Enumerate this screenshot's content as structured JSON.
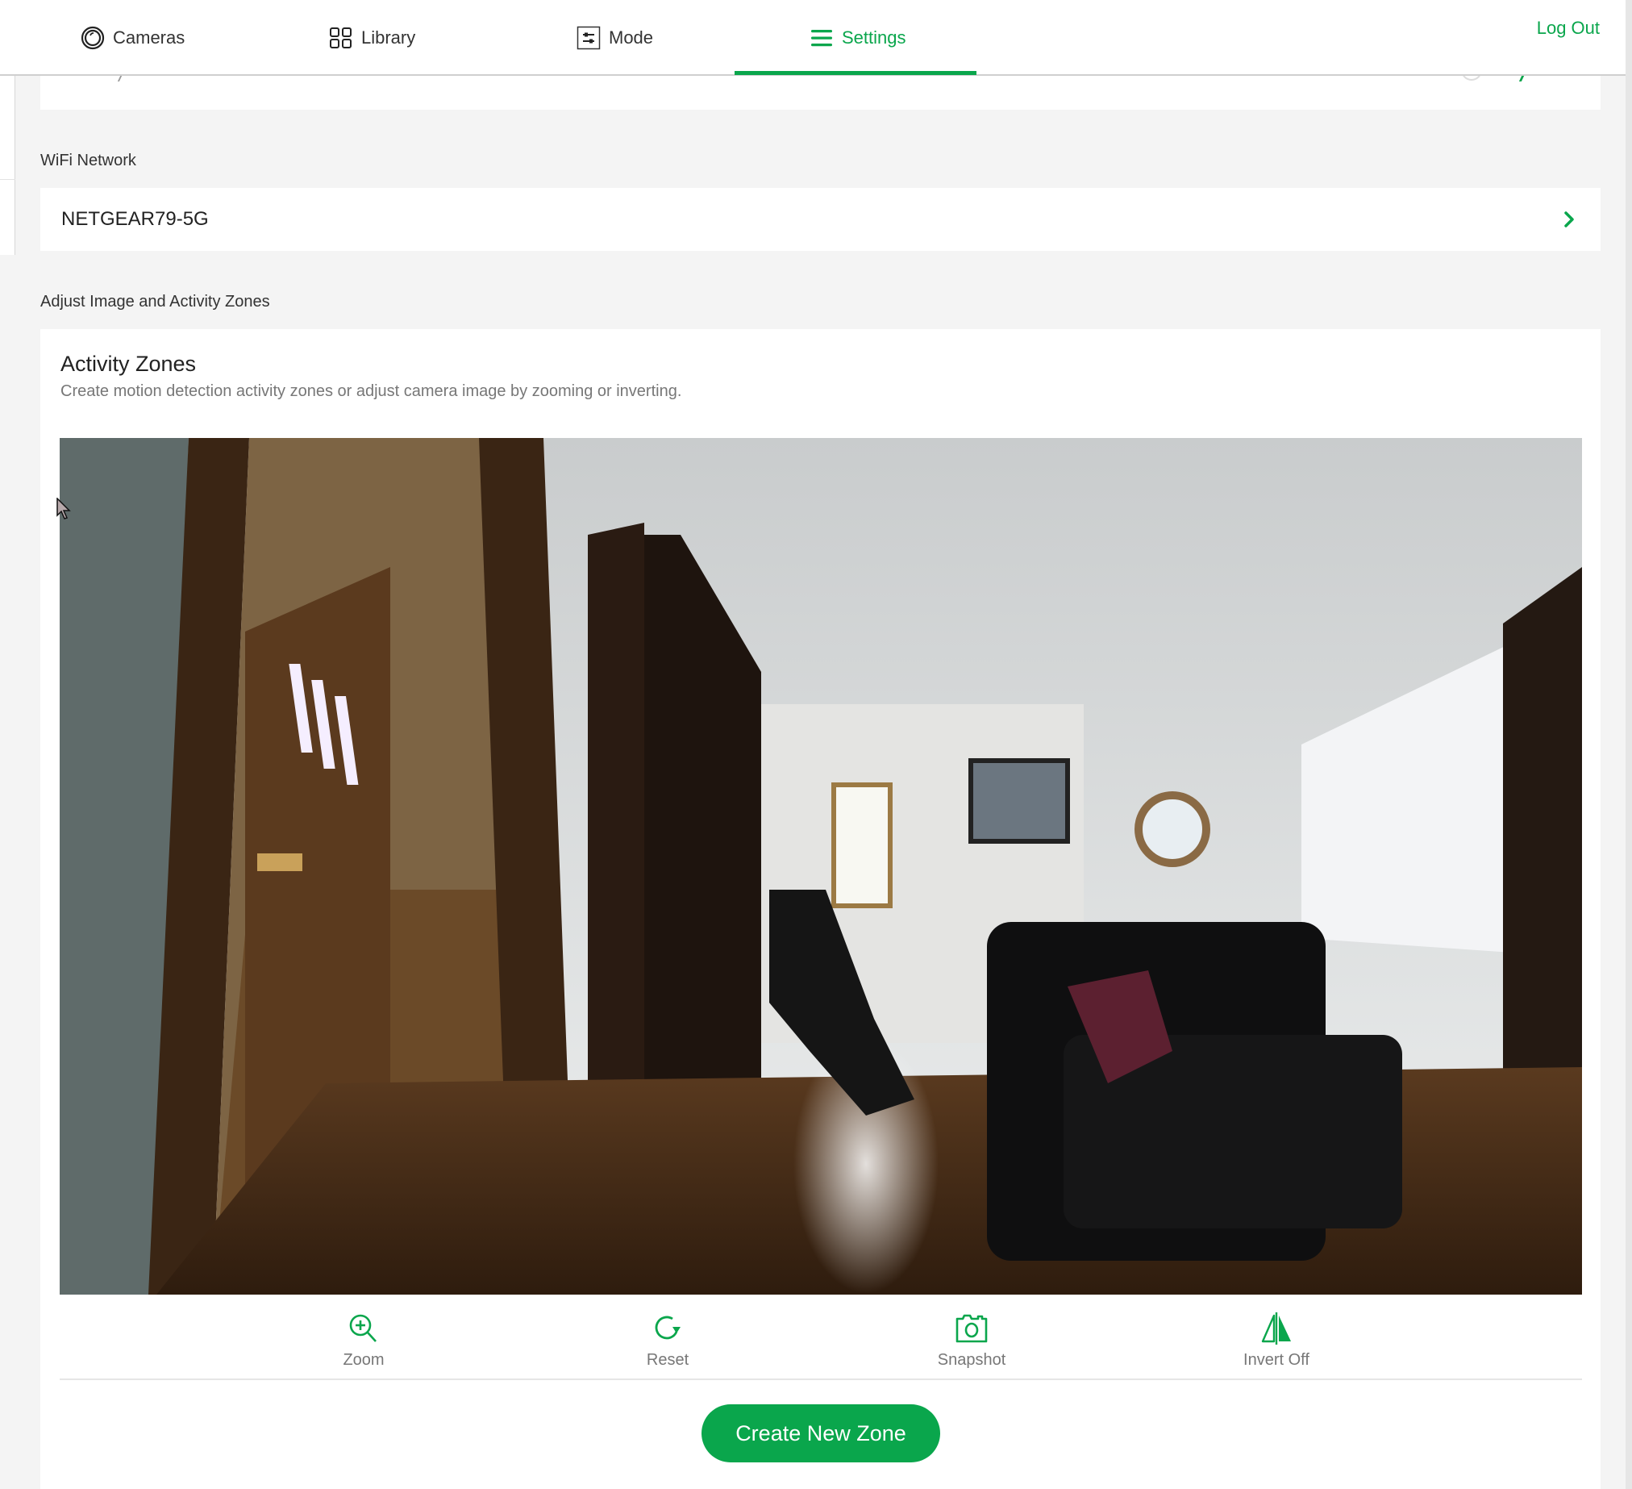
{
  "nav": {
    "items": [
      {
        "label": "Cameras",
        "icon": "camera-lens-icon",
        "active": false
      },
      {
        "label": "Library",
        "icon": "grid-icon",
        "active": false
      },
      {
        "label": "Mode",
        "icon": "sliders-icon",
        "active": false
      },
      {
        "label": "Settings",
        "icon": "menu-icon",
        "active": true
      }
    ],
    "logout_label": "Log Out",
    "accent_color": "#0aa64c"
  },
  "wifi": {
    "section_label": "WiFi Network",
    "network_name": "NETGEAR79-5G"
  },
  "zones": {
    "section_label": "Adjust Image and Activity Zones",
    "title": "Activity Zones",
    "description": "Create motion detection activity zones or adjust camera image by zooming or inverting.",
    "camera_feed_alt": "Live camera view of living room",
    "tools": [
      {
        "label": "Zoom",
        "icon": "zoom-in-icon"
      },
      {
        "label": "Reset",
        "icon": "reset-icon"
      },
      {
        "label": "Snapshot",
        "icon": "camera-icon"
      },
      {
        "label": "Invert Off",
        "icon": "invert-icon"
      }
    ],
    "create_button_label": "Create New Zone"
  }
}
